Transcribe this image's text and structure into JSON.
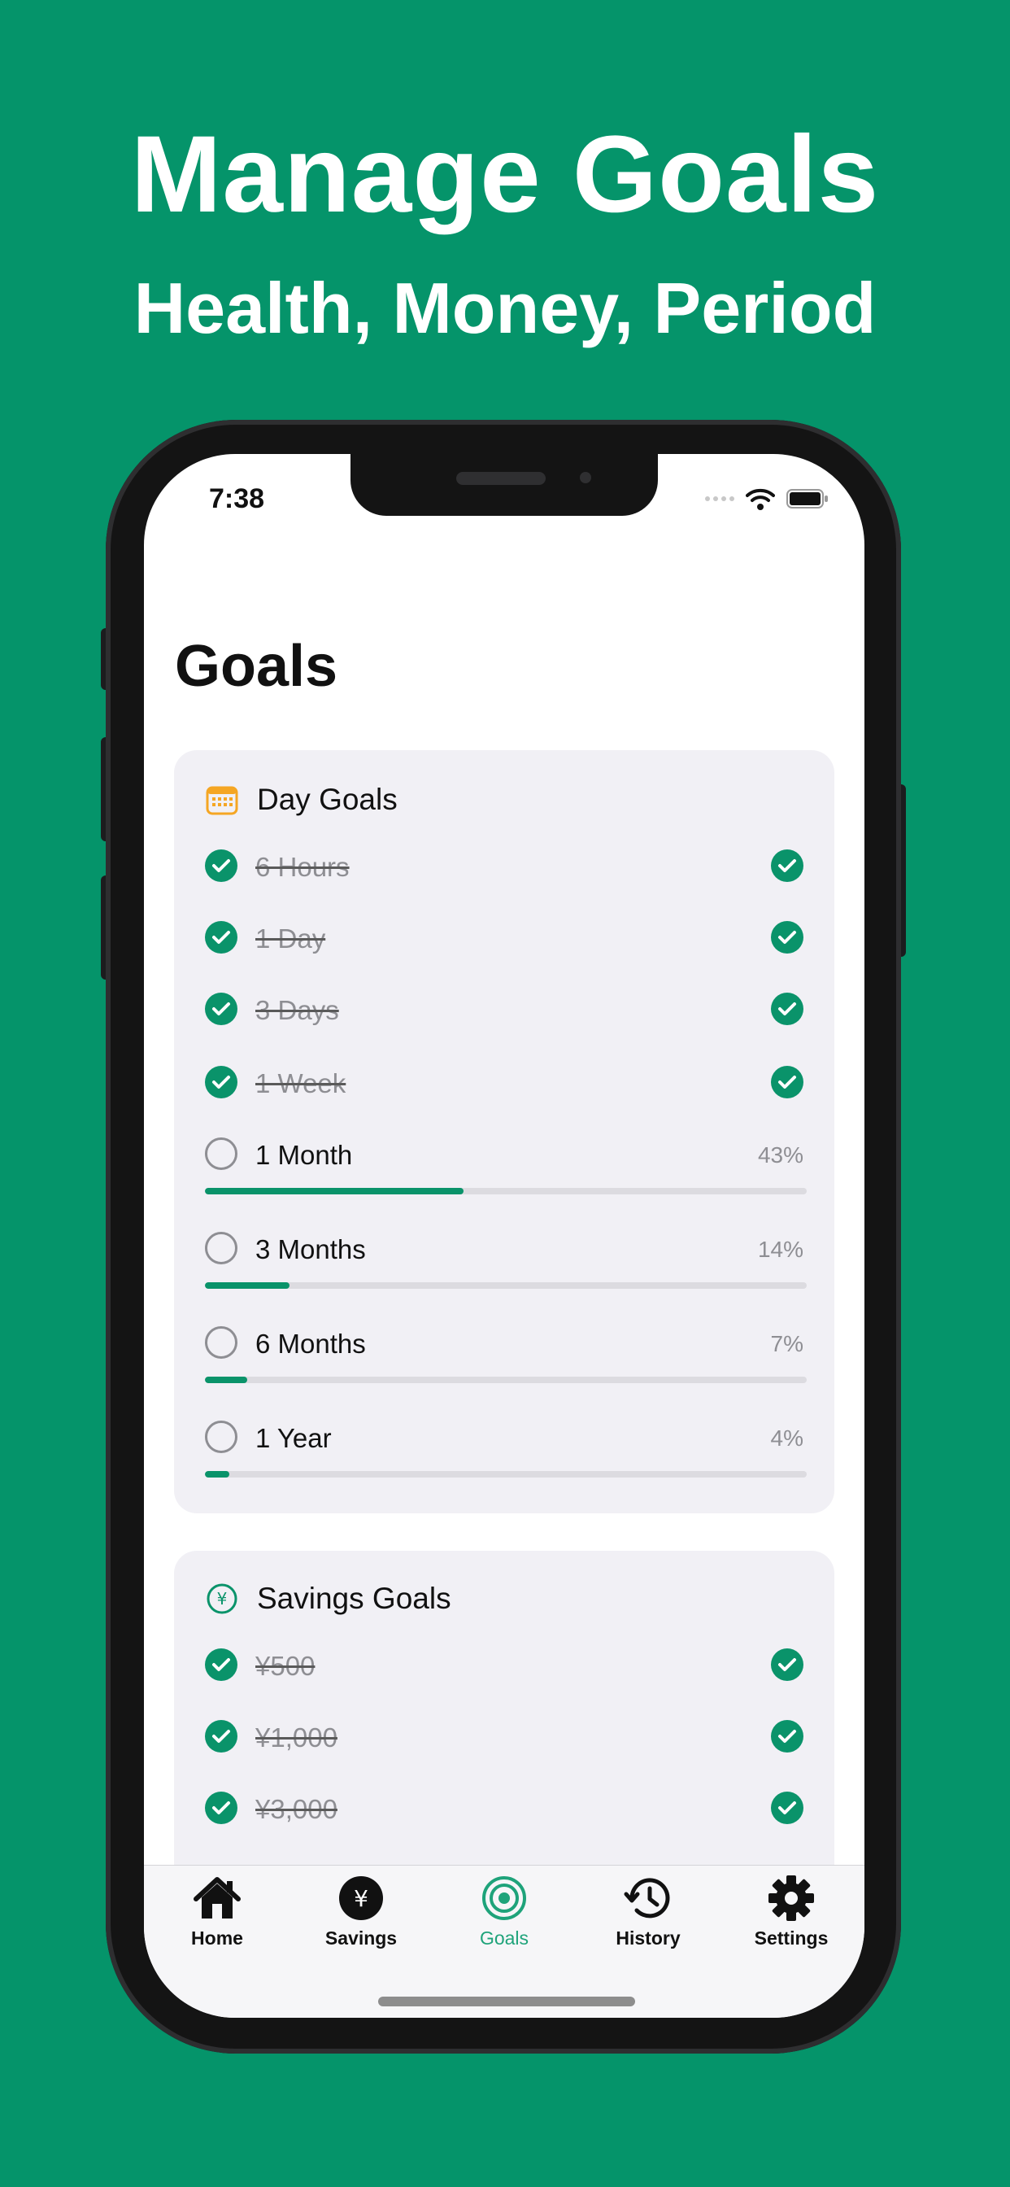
{
  "promo": {
    "title": "Manage Goals",
    "subtitle": "Health, Money, Period"
  },
  "status_bar": {
    "time": "7:38",
    "icons": [
      "signal-icon",
      "wifi-icon",
      "battery-icon"
    ]
  },
  "page": {
    "title": "Goals"
  },
  "day_goals": {
    "title": "Day Goals",
    "icon": "calendar-icon",
    "completed": [
      {
        "label": "6 Hours"
      },
      {
        "label": "1 Day"
      },
      {
        "label": "3 Days"
      },
      {
        "label": "1 Week"
      }
    ],
    "in_progress": [
      {
        "label": "1 Month",
        "percent": "43%",
        "progress": 0.43
      },
      {
        "label": "3 Months",
        "percent": "14%",
        "progress": 0.14
      },
      {
        "label": "6 Months",
        "percent": "7%",
        "progress": 0.07
      },
      {
        "label": "1 Year",
        "percent": "4%",
        "progress": 0.04
      }
    ]
  },
  "savings_goals": {
    "title": "Savings Goals",
    "icon": "yen-circle-icon",
    "completed": [
      {
        "label": "¥500"
      },
      {
        "label": "¥1,000"
      },
      {
        "label": "¥3,000"
      }
    ]
  },
  "tab_bar": {
    "tabs": [
      {
        "label": "Home",
        "icon": "house-icon",
        "active": false
      },
      {
        "label": "Savings",
        "icon": "yen-coin-icon",
        "active": false
      },
      {
        "label": "Goals",
        "icon": "target-icon",
        "active": true
      },
      {
        "label": "History",
        "icon": "history-clock-icon",
        "active": false
      },
      {
        "label": "Settings",
        "icon": "gear-icon",
        "active": false
      }
    ]
  },
  "colors": {
    "background": "#05946a",
    "accent": "#0a936a",
    "card": "#f1f0f5",
    "calendar_icon": "#f5a623"
  }
}
